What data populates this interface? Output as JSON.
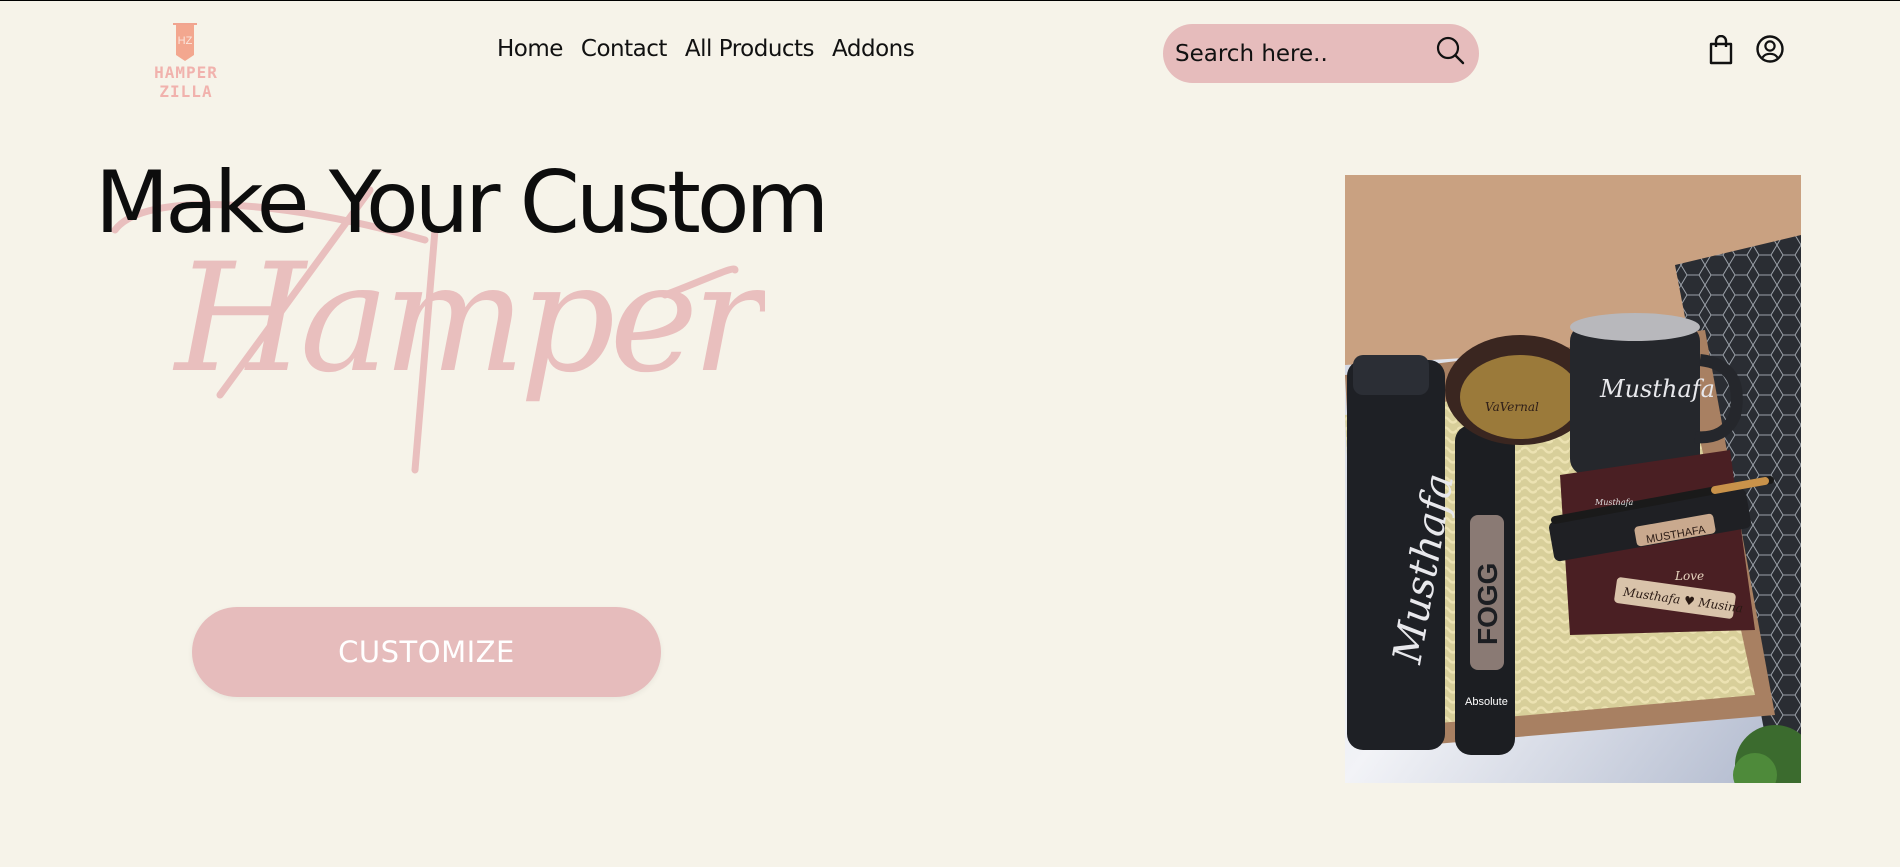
{
  "brand": {
    "logo_initials": "HZ",
    "logo_name": "HAMPER ZILLA",
    "accent_color": "#f1b2ad"
  },
  "nav": {
    "items": [
      "Home",
      "Contact",
      "All Products",
      "Addons"
    ]
  },
  "search": {
    "placeholder": "Search here..",
    "icon": "search-icon"
  },
  "header_icons": [
    "shopping-bag-icon",
    "user-circle-icon"
  ],
  "hero": {
    "title": "Make Your Custom",
    "script_text": "Hamper",
    "cta_label": "CUSTOMIZE",
    "cta_color": "#e6bcbc",
    "product_image_text": {
      "bottle_name": "Musthafa",
      "mug_name": "Musthafa",
      "spray_brand": "FOGG",
      "spray_variant": "Absolute",
      "keychain_name": "MUSTHAFA",
      "wallet_text": "Musthafa ♥ Musina",
      "pen_text": "Musthafa",
      "chocolate_brand": "VaVernal",
      "wallet_love": "Love"
    }
  },
  "colors": {
    "background": "#f6f3e9",
    "pink": "#e6bcbc",
    "script_pink": "#e9bfbe"
  }
}
